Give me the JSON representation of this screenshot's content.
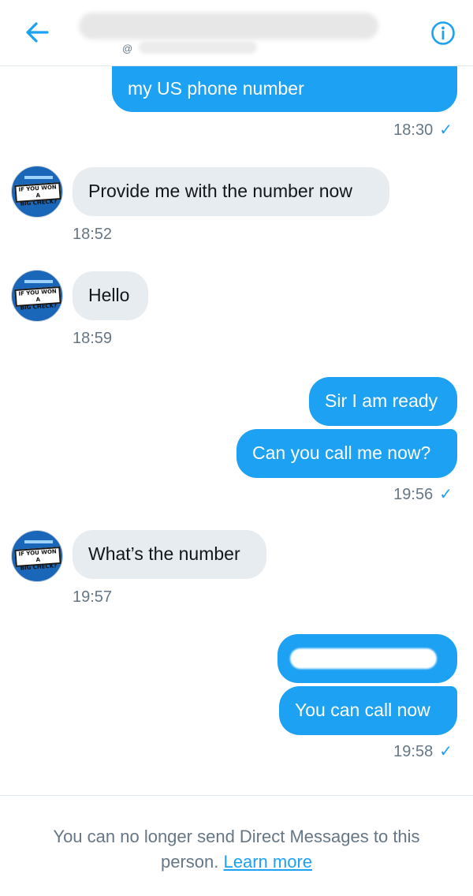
{
  "header": {
    "handle_prefix": "@"
  },
  "messages": {
    "m1": {
      "text": "my US phone number"
    },
    "t1": {
      "time": "18:30"
    },
    "m2": {
      "text": "Provide me with the number now"
    },
    "t2": {
      "time": "18:52"
    },
    "m3": {
      "text": "Hello"
    },
    "t3": {
      "time": "18:59"
    },
    "m4": {
      "text": "Sir I am ready"
    },
    "m5": {
      "text": "Can you call me now?"
    },
    "t4": {
      "time": "19:56"
    },
    "m6": {
      "text": "What’s the number"
    },
    "t5": {
      "time": "19:57"
    },
    "m8": {
      "text": "You can call now"
    },
    "t6": {
      "time": "19:58"
    }
  },
  "avatar": {
    "line1": "IF YOU WON A",
    "line2": "BIG CHECK?"
  },
  "check_mark": "✓",
  "footer": {
    "notice": "You can no longer send Direct Messages to this",
    "notice2": "person.",
    "learn_more": "Learn more"
  },
  "colors": {
    "accent": "#1da1f2",
    "incoming": "#e6ecf0"
  },
  "icons": {
    "back": "arrow-left-icon",
    "info": "info-icon"
  }
}
